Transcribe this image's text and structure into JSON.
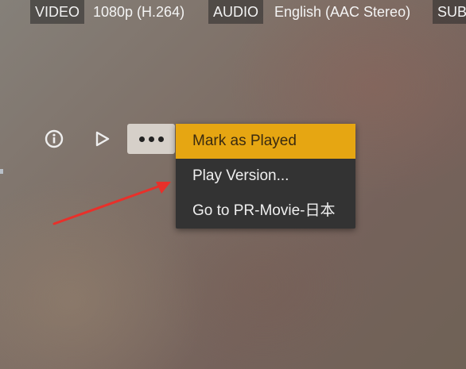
{
  "info_bar": {
    "video_label": "VIDEO",
    "video_value": "1080p (H.264)",
    "audio_label": "AUDIO",
    "audio_value": "English (AAC Stereo)",
    "subtitle_label": "SUB"
  },
  "controls": {
    "info_icon": "info-circle-icon",
    "play_icon": "play-triangle-icon",
    "more_icon": "more-dots-icon"
  },
  "menu": {
    "items": [
      {
        "label": "Mark as Played",
        "active": true
      },
      {
        "label": "Play Version..."
      },
      {
        "label": "Go to PR-Movie-日本"
      }
    ]
  },
  "colors": {
    "highlight": "#e6a612",
    "menu_bg": "#333333",
    "arrow": "#e8302a"
  }
}
